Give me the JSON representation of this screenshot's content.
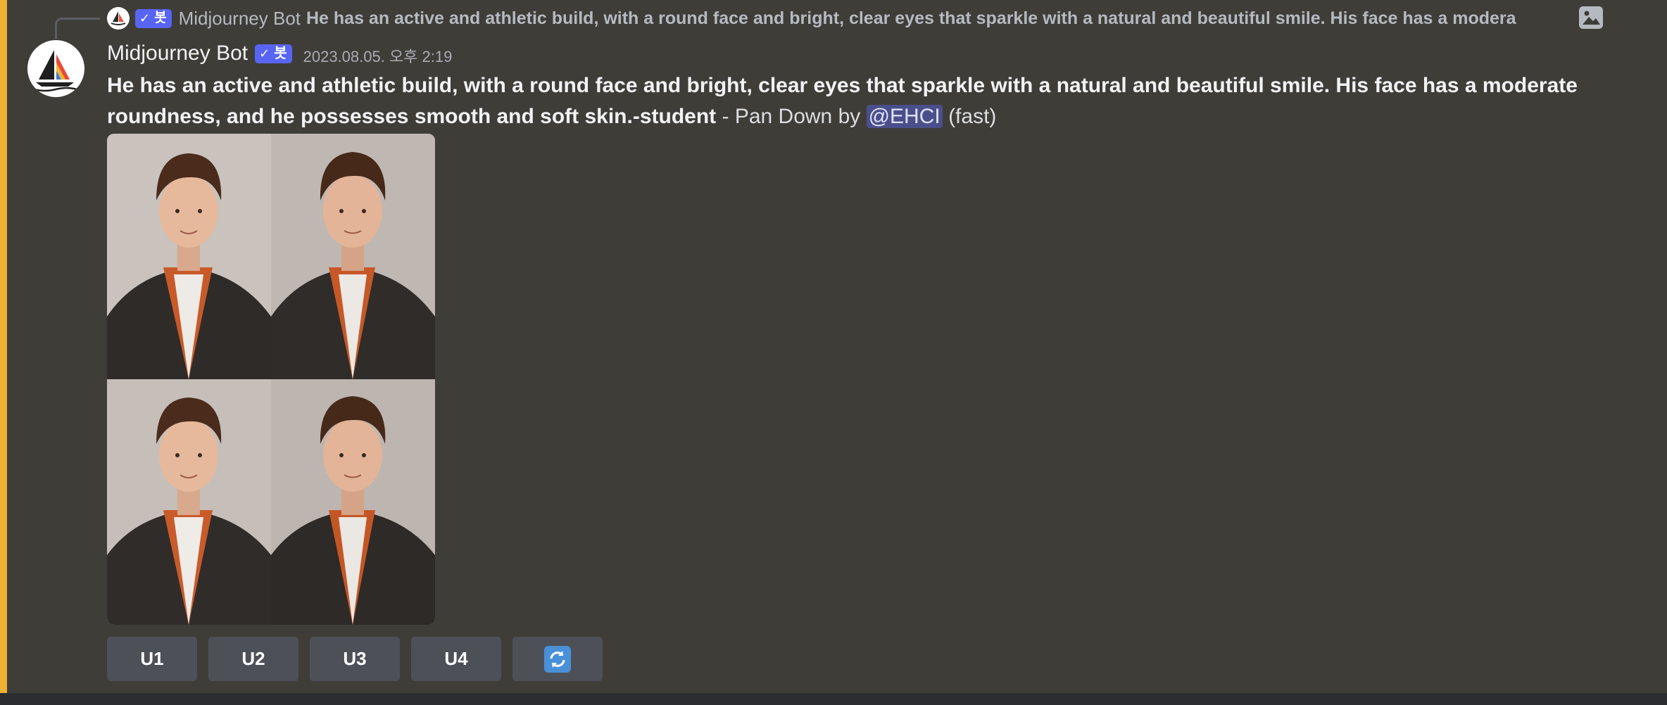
{
  "reply": {
    "author": "Midjourney Bot",
    "bot_tag": "봇",
    "text": "He has an active and athletic build, with a round face and bright, clear eyes that sparkle with a natural and beautiful smile. His face has a modera",
    "attachment_icon": "image-icon"
  },
  "message": {
    "author": "Midjourney Bot",
    "bot_tag": "봇",
    "timestamp": "2023.08.05. 오후 2:19",
    "prompt": "He has an active and athletic build, with a round face and bright, clear eyes that sparkle with a natural and beautiful smile. His face has a moderate roundness, and he possesses smooth and soft skin.-student",
    "suffix": " - Pan Down by ",
    "mention": "@EHCI",
    "speed": " (fast)"
  },
  "image_grid": {
    "tiles": [
      "image-1",
      "image-2",
      "image-3",
      "image-4"
    ]
  },
  "buttons": [
    {
      "label": "U1"
    },
    {
      "label": "U2"
    },
    {
      "label": "U3"
    },
    {
      "label": "U4"
    },
    {
      "label": "",
      "icon": "refresh-icon"
    }
  ],
  "colors": {
    "background": "#3f3d38",
    "highlight": "#f0b232",
    "bot_tag": "#5865f2",
    "button": "#4e5058",
    "mention_bg": "#5865f2"
  }
}
